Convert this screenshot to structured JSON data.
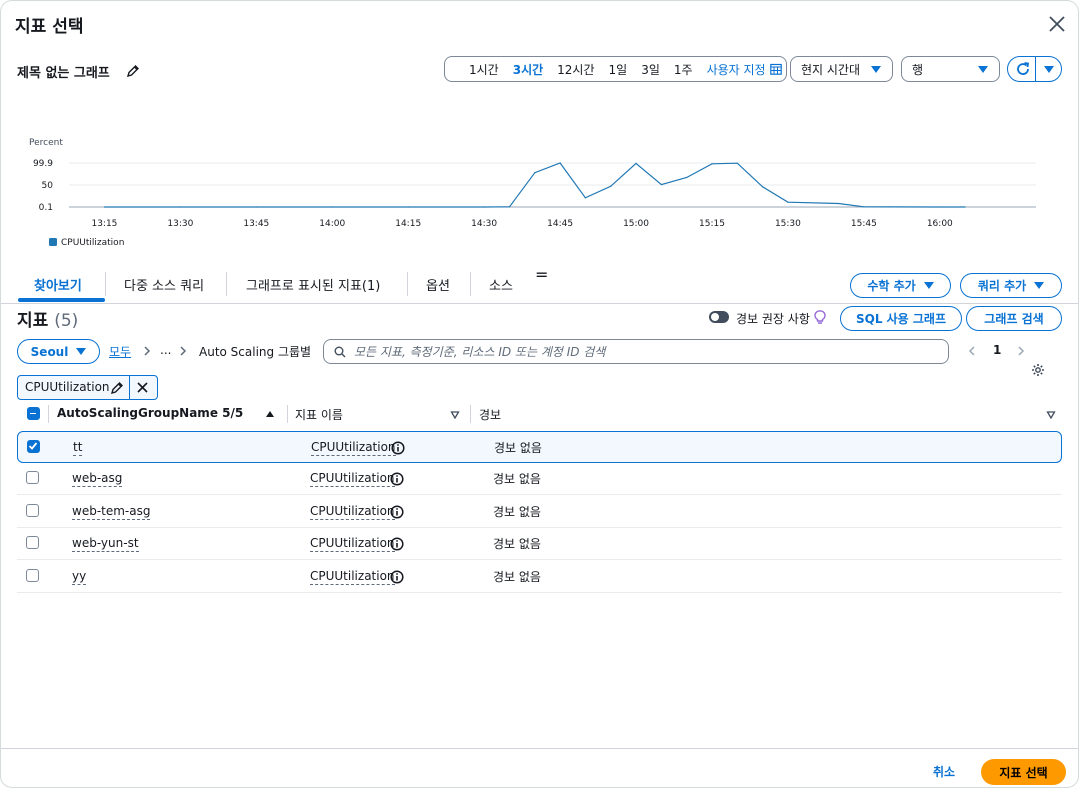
{
  "modal": {
    "title": "지표 선택"
  },
  "graph": {
    "title": "제목 없는 그래프"
  },
  "time_range": {
    "options": [
      "1시간",
      "3시간",
      "12시간",
      "1일",
      "3일",
      "1주"
    ],
    "selected": "3시간",
    "custom_label": "사용자 지정"
  },
  "timezone": {
    "value": "현지 시간대"
  },
  "view": {
    "value": "행"
  },
  "chart_data": {
    "type": "line",
    "ylabel": "Percent",
    "yticks": [
      "99.9",
      "50",
      "0.1"
    ],
    "ylim": [
      0.1,
      99.9
    ],
    "xticks": [
      "13:15",
      "13:30",
      "13:45",
      "14:00",
      "14:15",
      "14:30",
      "14:45",
      "15:00",
      "15:15",
      "15:30",
      "15:45",
      "16:00"
    ],
    "series": [
      {
        "name": "CPUUtilization",
        "color": "#1f77b4",
        "points": [
          [
            "13:15",
            0.1
          ],
          [
            "13:30",
            0.1
          ],
          [
            "13:45",
            0.1
          ],
          [
            "14:00",
            0.1
          ],
          [
            "14:15",
            0.1
          ],
          [
            "14:30",
            0.1
          ],
          [
            "14:35",
            0.5
          ],
          [
            "14:40",
            78
          ],
          [
            "14:45",
            99.9
          ],
          [
            "14:50",
            21
          ],
          [
            "14:55",
            47
          ],
          [
            "15:00",
            99
          ],
          [
            "15:05",
            51
          ],
          [
            "15:10",
            67
          ],
          [
            "15:15",
            98
          ],
          [
            "15:20",
            99.5
          ],
          [
            "15:25",
            46
          ],
          [
            "15:30",
            11
          ],
          [
            "15:40",
            8
          ],
          [
            "15:45",
            0.5
          ],
          [
            "15:50",
            0.3
          ],
          [
            "16:00",
            0.2
          ],
          [
            "16:05",
            0.2
          ]
        ]
      }
    ]
  },
  "tabs": [
    "찾아보기",
    "다중 소스 쿼리",
    "그래프로 표시된 지표(1)",
    "옵션",
    "소스"
  ],
  "tab_extra_icon": "=",
  "buttons": {
    "math": "수학 추가",
    "query": "쿼리 추가",
    "sql": "SQL 사용 그래프",
    "search_graph": "그래프 검색",
    "cancel": "취소",
    "select": "지표 선택"
  },
  "metrics": {
    "title": "지표",
    "count": "(5)",
    "alarm_toggle_label": "경보 권장 사항",
    "region": "Seoul",
    "breadcrumb": [
      "모두",
      "...",
      "Auto Scaling 그룹별"
    ],
    "search_placeholder": "모든 지표, 측정기준, 리소스 ID 또는 계정 ID 검색",
    "page": "1",
    "filter_token": "CPUUtilization",
    "columns": [
      "AutoScalingGroupName 5/5",
      "지표 이름",
      "경보"
    ],
    "rows": [
      {
        "group": "tt",
        "metric": "CPUUtilization",
        "alarm": "경보 없음",
        "checked": true
      },
      {
        "group": "web-asg",
        "metric": "CPUUtilization",
        "alarm": "경보 없음",
        "checked": false
      },
      {
        "group": "web-tem-asg",
        "metric": "CPUUtilization",
        "alarm": "경보 없음",
        "checked": false
      },
      {
        "group": "web-yun-st",
        "metric": "CPUUtilization",
        "alarm": "경보 없음",
        "checked": false
      },
      {
        "group": "yy",
        "metric": "CPUUtilization",
        "alarm": "경보 없음",
        "checked": false
      }
    ]
  }
}
